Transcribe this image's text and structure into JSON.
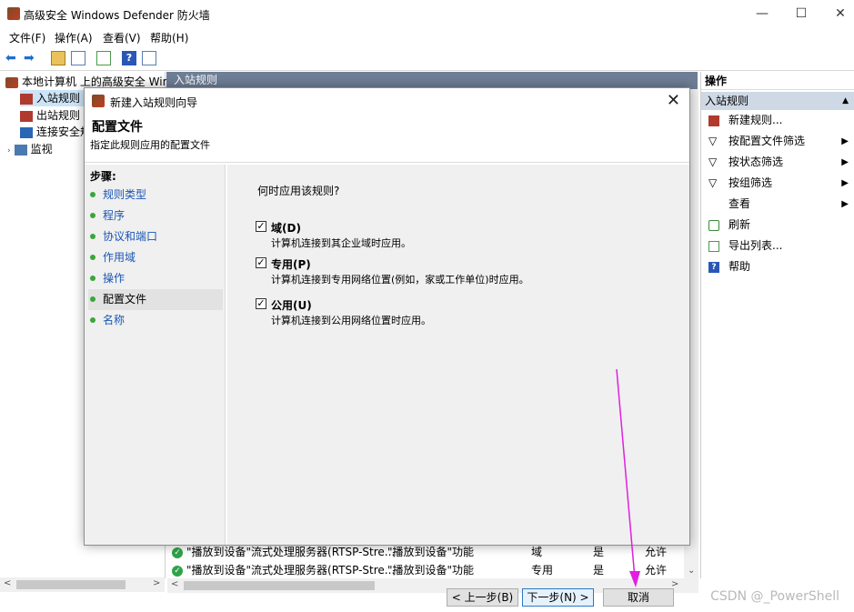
{
  "window": {
    "title": "高级安全 Windows Defender 防火墙",
    "min": "—",
    "max": "☐",
    "close": "✕"
  },
  "menu": [
    "文件(F)",
    "操作(A)",
    "查看(V)",
    "帮助(H)"
  ],
  "tree": {
    "root": "本地计算机 上的高级安全 Wind",
    "items": [
      "入站规则",
      "出站规则",
      "连接安全规",
      "监视"
    ]
  },
  "center": {
    "header": "入站规则",
    "rows": [
      {
        "name": "\"播放到设备\"流式处理服务器(RTSP-Stre...",
        "group": "\"播放到设备\"功能",
        "profile": "域",
        "enabled": "是",
        "action": "允许"
      },
      {
        "name": "\"播放到设备\"流式处理服务器(RTSP-Stre...",
        "group": "\"播放到设备\"功能",
        "profile": "专用",
        "enabled": "是",
        "action": "允许"
      }
    ]
  },
  "actions": {
    "header": "操作",
    "section": "入站规则",
    "items": [
      {
        "label": "新建规则...",
        "icon": "new-rule-icon",
        "submenu": false
      },
      {
        "label": "按配置文件筛选",
        "icon": "filter-icon",
        "submenu": true
      },
      {
        "label": "按状态筛选",
        "icon": "filter-icon",
        "submenu": true
      },
      {
        "label": "按组筛选",
        "icon": "filter-icon",
        "submenu": true
      },
      {
        "label": "查看",
        "icon": "",
        "submenu": true
      },
      {
        "label": "刷新",
        "icon": "refresh-icon",
        "submenu": false
      },
      {
        "label": "导出列表...",
        "icon": "export-icon",
        "submenu": false
      },
      {
        "label": "帮助",
        "icon": "help-icon",
        "submenu": false
      }
    ]
  },
  "dialog": {
    "title": "新建入站规则向导",
    "heading": "配置文件",
    "subheading": "指定此规则应用的配置文件",
    "steps_title": "步骤:",
    "steps": [
      "规则类型",
      "程序",
      "协议和端口",
      "作用域",
      "操作",
      "配置文件",
      "名称"
    ],
    "active_step": 5,
    "question": "何时应用该规则?",
    "options": [
      {
        "label": "域(D)",
        "desc": "计算机连接到其企业域时应用。",
        "checked": true
      },
      {
        "label": "专用(P)",
        "desc": "计算机连接到专用网络位置(例如，家或工作单位)时应用。",
        "checked": true
      },
      {
        "label": "公用(U)",
        "desc": "计算机连接到公用网络位置时应用。",
        "checked": true
      }
    ],
    "buttons": {
      "back": "< 上一步(B)",
      "next": "下一步(N) >",
      "cancel": "取消"
    }
  },
  "watermark": "CSDN @_PowerShell",
  "colors": {
    "header_bg": "#6e7e96",
    "link": "#1a56b6",
    "accent_arrow": "#e020e0"
  }
}
